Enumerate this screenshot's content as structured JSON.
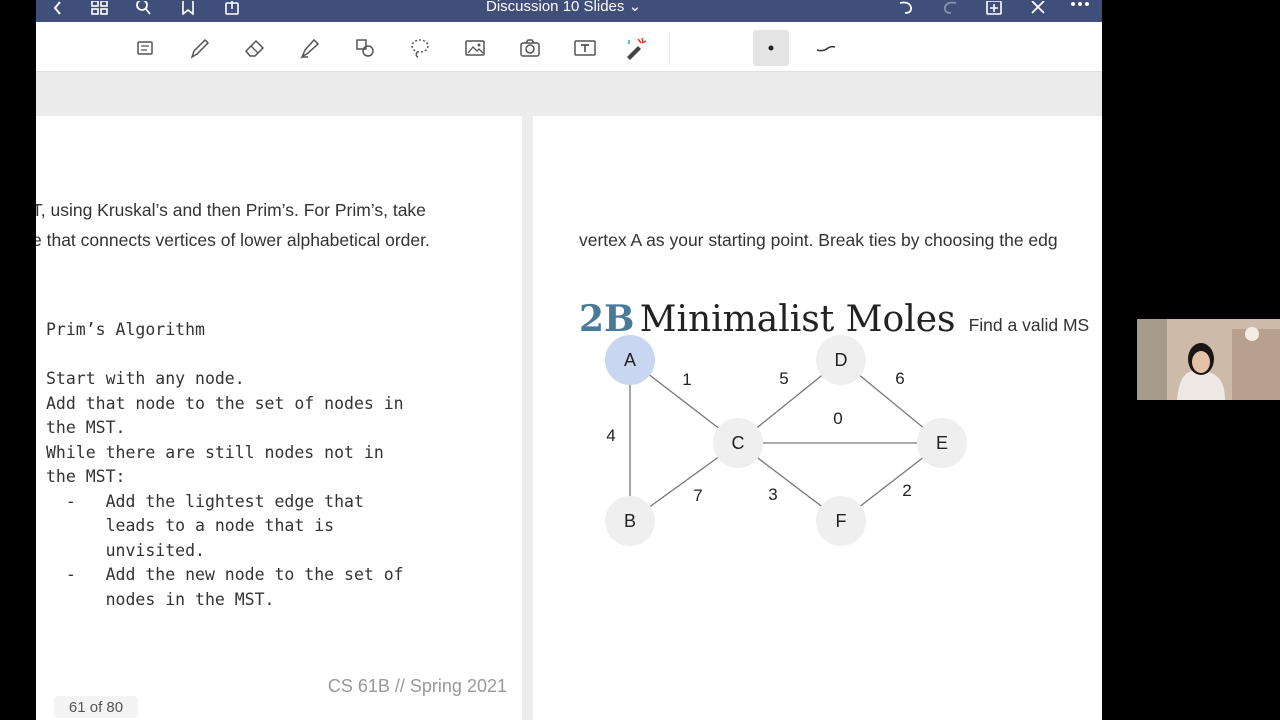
{
  "header": {
    "title": "Discussion 10 Slides ⌄",
    "icons": [
      "back-icon",
      "grid-icon",
      "search-icon",
      "bookmark-icon",
      "share-icon",
      "undo-icon",
      "redo-icon",
      "add-page-icon",
      "close-icon",
      "more-icon"
    ]
  },
  "toolbar": {
    "tools": [
      "scan-icon",
      "pen-icon",
      "eraser-icon",
      "highlighter-icon",
      "shapes-icon",
      "lasso-icon",
      "image-icon",
      "camera-icon",
      "textbox-icon",
      "laser-pointer-icon",
      "dot-icon",
      "stroke-icon"
    ]
  },
  "left_page": {
    "line1": "T, using Kruskal’s and then Prim’s. For Prim’s, take",
    "line2": "e that connects vertices of lower alphabetical order.",
    "code_lines": [
      "Prim’s Algorithm",
      "",
      "Start with any node.",
      "Add that node to the set of nodes in",
      "the MST.",
      "While there are still nodes not in",
      "the MST:",
      "  -   Add the lightest edge that",
      "      leads to a node that is",
      "      unvisited.",
      "  -   Add the new node to the set of",
      "      nodes in the MST."
    ],
    "footer": "CS 61B // Spring 2021"
  },
  "right_page": {
    "title_num": "2B",
    "title_text": "Minimalist Moles",
    "title_tail": "Find a valid MS",
    "line2": "vertex A as your starting point. Break ties by choosing the edg"
  },
  "graph": {
    "nodes": [
      {
        "id": "A",
        "highlight": true
      },
      {
        "id": "B",
        "highlight": false
      },
      {
        "id": "C",
        "highlight": false
      },
      {
        "id": "D",
        "highlight": false
      },
      {
        "id": "E",
        "highlight": false
      },
      {
        "id": "F",
        "highlight": false
      }
    ],
    "edges": [
      {
        "from": "A",
        "to": "C",
        "weight": "1"
      },
      {
        "from": "A",
        "to": "B",
        "weight": "4"
      },
      {
        "from": "B",
        "to": "C",
        "weight": "7"
      },
      {
        "from": "C",
        "to": "D",
        "weight": "5"
      },
      {
        "from": "D",
        "to": "E",
        "weight": "6"
      },
      {
        "from": "C",
        "to": "E",
        "weight": "0"
      },
      {
        "from": "C",
        "to": "F",
        "weight": "3"
      },
      {
        "from": "F",
        "to": "E",
        "weight": "2"
      }
    ],
    "colors": {
      "node": "#efefef",
      "highlight": "#c9d6f2",
      "edge": "#777777"
    }
  },
  "status": {
    "page_count": "61 of 80"
  },
  "colors": {
    "nav": "#3f4f7a",
    "accent": "#4a7a9a"
  }
}
